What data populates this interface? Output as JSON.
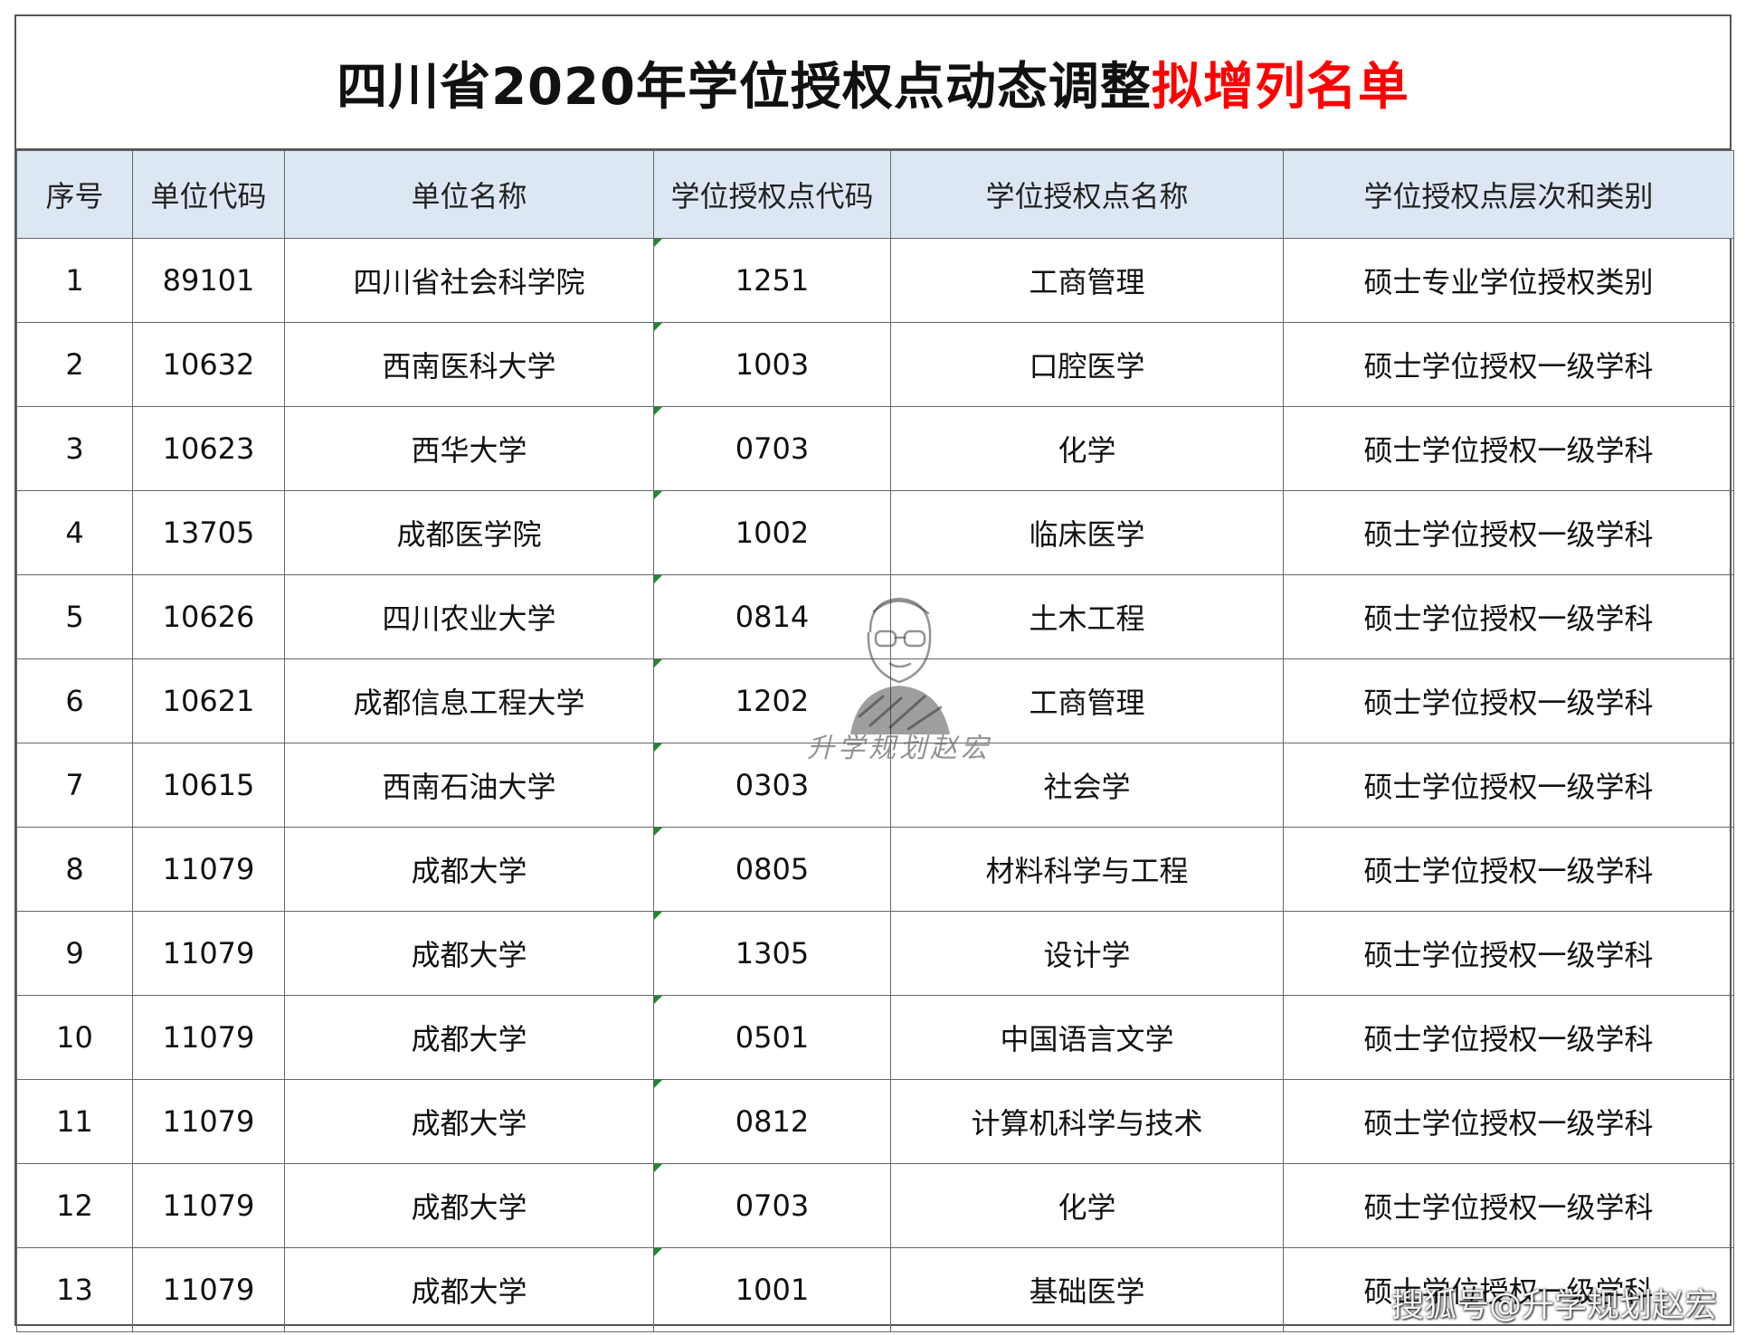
{
  "title": {
    "main": "四川省2020年学位授权点动态调整",
    "highlight": "拟增列名单",
    "highlight_color": "#ff0000"
  },
  "table": {
    "header_bg": "#dde7f3",
    "columns": [
      "序号",
      "单位代码",
      "单位名称",
      "学位授权点代码",
      "学位授权点名称",
      "学位授权点层次和类别"
    ],
    "rows": [
      [
        "1",
        "89101",
        "四川省社会科学院",
        "1251",
        "工商管理",
        "硕士专业学位授权类别"
      ],
      [
        "2",
        "10632",
        "西南医科大学",
        "1003",
        "口腔医学",
        "硕士学位授权一级学科"
      ],
      [
        "3",
        "10623",
        "西华大学",
        "0703",
        "化学",
        "硕士学位授权一级学科"
      ],
      [
        "4",
        "13705",
        "成都医学院",
        "1002",
        "临床医学",
        "硕士学位授权一级学科"
      ],
      [
        "5",
        "10626",
        "四川农业大学",
        "0814",
        "土木工程",
        "硕士学位授权一级学科"
      ],
      [
        "6",
        "10621",
        "成都信息工程大学",
        "1202",
        "工商管理",
        "硕士学位授权一级学科"
      ],
      [
        "7",
        "10615",
        "西南石油大学",
        "0303",
        "社会学",
        "硕士学位授权一级学科"
      ],
      [
        "8",
        "11079",
        "成都大学",
        "0805",
        "材料科学与工程",
        "硕士学位授权一级学科"
      ],
      [
        "9",
        "11079",
        "成都大学",
        "1305",
        "设计学",
        "硕士学位授权一级学科"
      ],
      [
        "10",
        "11079",
        "成都大学",
        "0501",
        "中国语言文学",
        "硕士学位授权一级学科"
      ],
      [
        "11",
        "11079",
        "成都大学",
        "0812",
        "计算机科学与技术",
        "硕士学位授权一级学科"
      ],
      [
        "12",
        "11079",
        "成都大学",
        "0703",
        "化学",
        "硕士学位授权一级学科"
      ],
      [
        "13",
        "11079",
        "成都大学",
        "1001",
        "基础医学",
        "硕士学位授权一级学科"
      ]
    ]
  },
  "watermark": {
    "text": "升学规划赵宏",
    "icon": "avatar-sketch-icon"
  },
  "corner_watermark": {
    "text": "搜狐号@升学规划赵宏"
  }
}
